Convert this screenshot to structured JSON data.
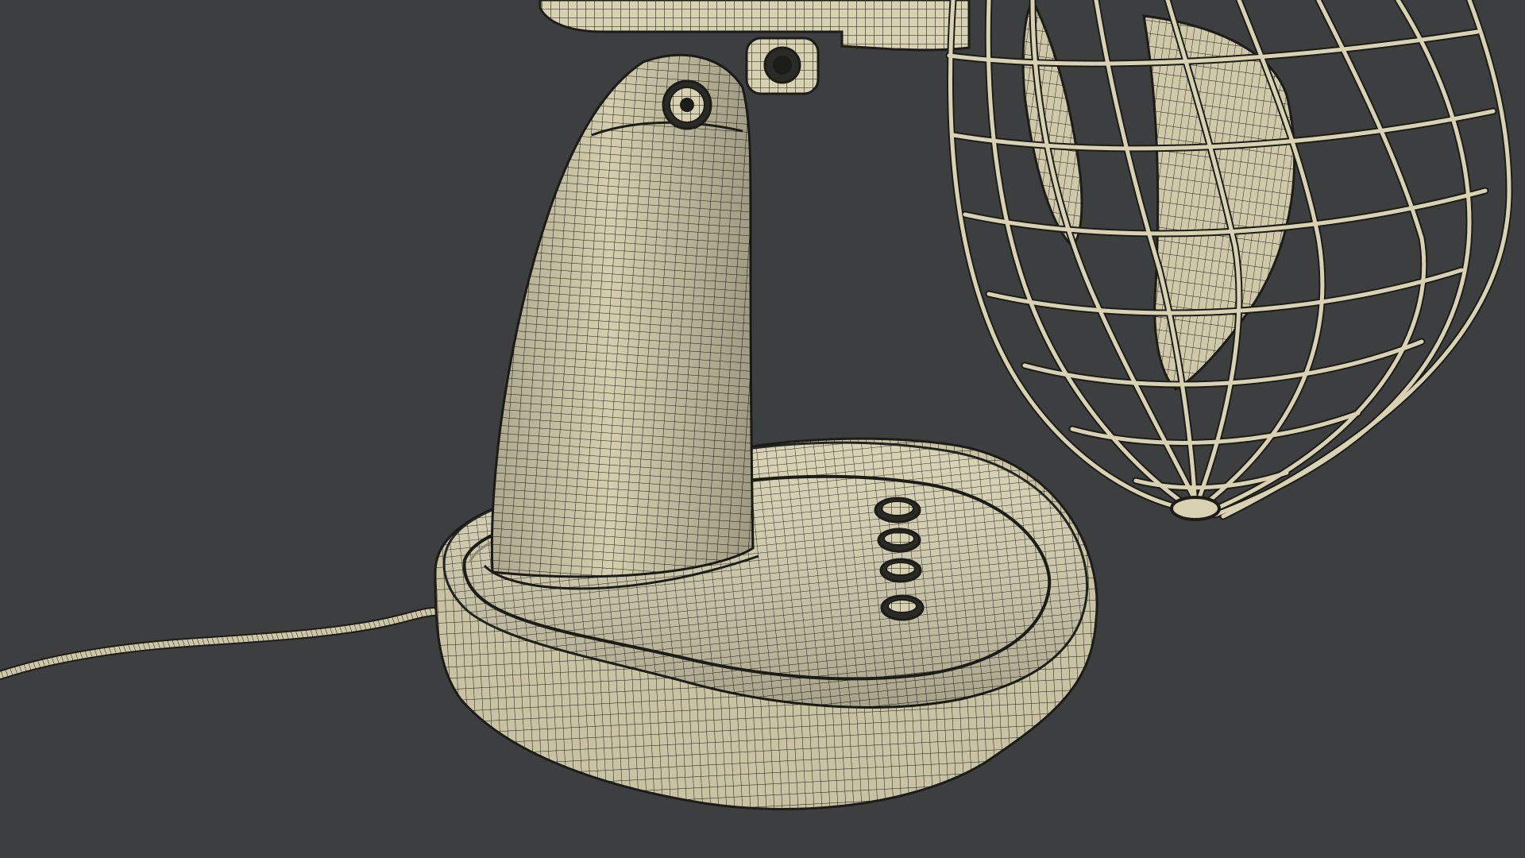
{
  "scene": {
    "subject": "wireframe-desk-fan-render",
    "colors": {
      "background": "#3d3e3f",
      "surface": "#d8d2b2",
      "surface_shade": "#b9b293",
      "surface_dark": "#8f8a70",
      "wire": "#1c1c18",
      "button_socket": "#2a2a26"
    },
    "parts": [
      "motor-housing",
      "tilt-joint-knob",
      "fan-stem",
      "fan-base",
      "speed-buttons",
      "power-cord",
      "fan-guard-cage",
      "fan-blade"
    ],
    "speed_button_count": 4
  }
}
